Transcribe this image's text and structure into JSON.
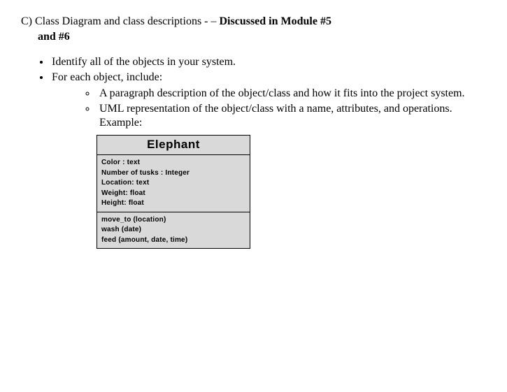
{
  "heading": {
    "label": "C)",
    "title": "Class Diagram and class descriptions - – ",
    "bold": "Discussed in Module #5",
    "bold_cont": "and #6"
  },
  "bullets": {
    "b1": "Identify all of the objects in your system.",
    "b2": "For each object, include:"
  },
  "subbullets": {
    "s1": "A paragraph description of the object/class and how it fits into the project system.",
    "s2": "UML representation of the object/class with a name, attributes, and operations.  Example:"
  },
  "uml": {
    "name": "Elephant",
    "attrs": {
      "a1": "Color : text",
      "a2": "Number of tusks : Integer",
      "a3": "Location: text",
      "a4": "Weight: float",
      "a5": "Height: float"
    },
    "ops": {
      "o1": "move_to (location)",
      "o2": "wash (date)",
      "o3": "feed (amount, date, time)"
    }
  }
}
